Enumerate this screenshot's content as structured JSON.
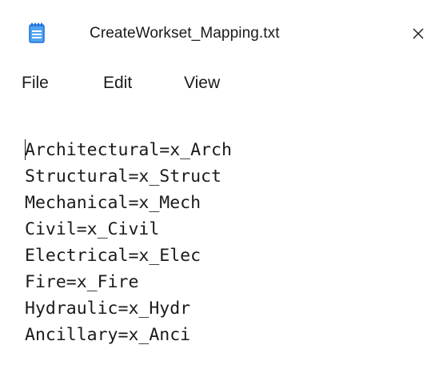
{
  "tab": {
    "icon": "notepad-icon",
    "title": "CreateWorkset_Mapping.txt",
    "close_icon": "close-icon"
  },
  "menu": {
    "file": "File",
    "edit": "Edit",
    "view": "View"
  },
  "editor": {
    "lines": [
      "Architectural=x_Arch",
      "Structural=x_Struct",
      "Mechanical=x_Mech",
      "Civil=x_Civil",
      "Electrical=x_Elec",
      "Fire=x_Fire",
      "Hydraulic=x_Hydr",
      "Ancillary=x_Anci"
    ]
  },
  "colors": {
    "icon_blue": "#1e6fd9",
    "icon_light": "#4fa3f0",
    "text": "#1a1a1a"
  }
}
